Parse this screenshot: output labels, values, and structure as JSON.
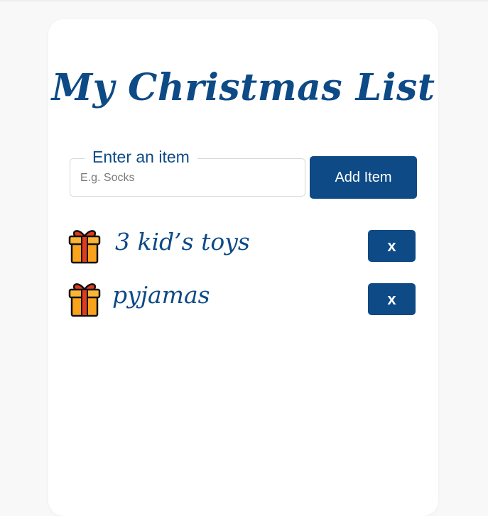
{
  "app": {
    "title": "My Christmas List"
  },
  "form": {
    "legend": "Enter an item",
    "placeholder": "E.g. Socks",
    "value": "",
    "add_label": "Add Item"
  },
  "items": [
    {
      "label": "3 kid’s toys",
      "icon": "gift-icon",
      "remove_label": "x"
    },
    {
      "label": "pyjamas",
      "icon": "gift-icon",
      "remove_label": "x"
    }
  ],
  "colors": {
    "accent": "#0d4a86",
    "background": "#f8f8f8",
    "card": "#ffffff",
    "gift_box": "#f9a21b",
    "gift_ribbon": "#e23a1e"
  }
}
